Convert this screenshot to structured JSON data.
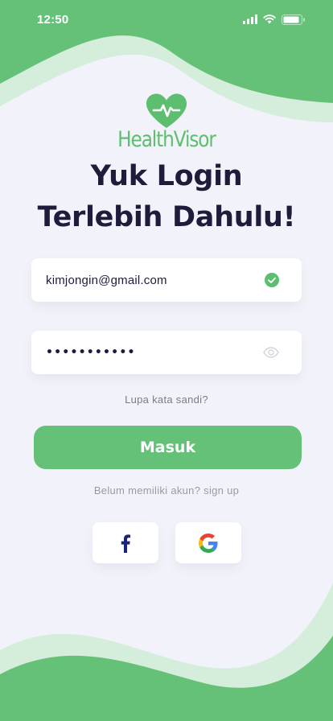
{
  "status_bar": {
    "time": "12:50"
  },
  "brand": {
    "name": "HealthVisor"
  },
  "headline": {
    "line1": "Yuk Login",
    "line2": "Terlebih Dahulu!"
  },
  "email_field": {
    "value": "kimjongin@gmail.com",
    "status_icon": "check-circle-icon"
  },
  "password_field": {
    "value": "•••••••••••",
    "toggle_icon": "eye-icon"
  },
  "forgot_password": {
    "label": "Lupa kata sandi?"
  },
  "login_button": {
    "label": "Masuk"
  },
  "signup_prompt": {
    "label": "Belum memiliki akun? sign up"
  },
  "social_buttons": [
    {
      "name": "facebook",
      "icon": "facebook-icon",
      "color": "#1a237e"
    },
    {
      "name": "google",
      "icon": "google-icon"
    }
  ],
  "colors": {
    "accent_green": "#66c178",
    "light_green": "#d5eddb",
    "background": "#f2f3fa",
    "heading": "#1d1d3b"
  }
}
